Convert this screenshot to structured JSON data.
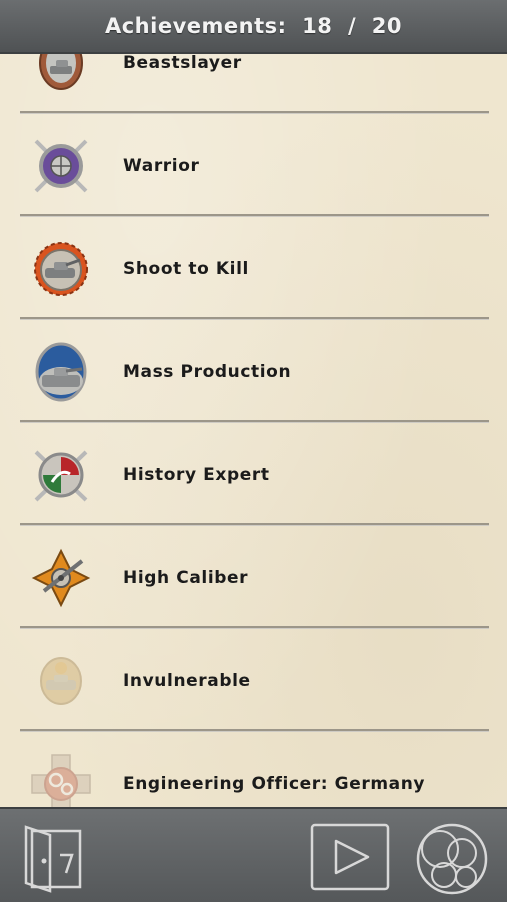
{
  "header": {
    "title": "Achievements:  18  /  20"
  },
  "achievements": [
    {
      "label": "Beastslayer",
      "icon": "beastslayer-medal-icon",
      "locked": false
    },
    {
      "label": "Warrior",
      "icon": "warrior-medal-icon",
      "locked": false
    },
    {
      "label": "Shoot to Kill",
      "icon": "shoot-to-kill-medal-icon",
      "locked": false
    },
    {
      "label": "Mass Production",
      "icon": "mass-production-medal-icon",
      "locked": false
    },
    {
      "label": "History Expert",
      "icon": "history-expert-medal-icon",
      "locked": false
    },
    {
      "label": "High Caliber",
      "icon": "high-caliber-medal-icon",
      "locked": false
    },
    {
      "label": "Invulnerable",
      "icon": "invulnerable-medal-icon",
      "locked": true
    },
    {
      "label": "Engineering Officer: Germany",
      "icon": "engineering-officer-medal-icon",
      "locked": true
    }
  ],
  "footer": {
    "icons": [
      "exit-door-icon",
      "play-icon",
      "game-center-icon"
    ]
  },
  "colors": {
    "header": "#5c5f61",
    "paper": "#efe6cf",
    "separator": "#9c9689",
    "text": "#1b1b1b"
  }
}
